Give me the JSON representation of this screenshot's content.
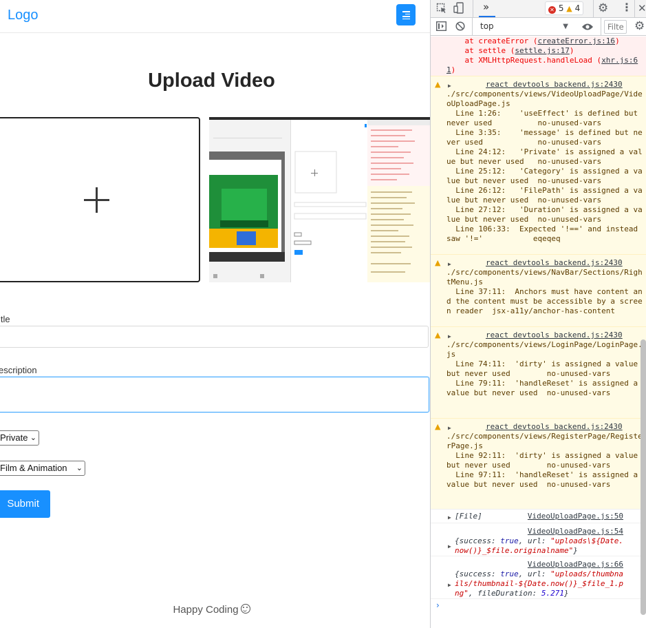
{
  "app": {
    "logo": "Logo",
    "heading": "Upload Video",
    "form": {
      "title_label": "itle",
      "description_label": "escription",
      "privacy_value": "Private",
      "category_value": "Film & Animation",
      "submit_label": "Submit"
    },
    "footer": "Happy Coding"
  },
  "devtools": {
    "more_tabs": "»",
    "errors": "5",
    "warnings": "4",
    "context": "top",
    "filter_placeholder": "Filte",
    "error_trace": [
      "    at createError (",
      "createError.js:16",
      ")",
      "    at settle (",
      "settle.js:17",
      ")",
      "    at XMLHttpRequest.handleLoad (",
      "xhr.js:61",
      ")"
    ],
    "warnings_list": [
      {
        "source": "react devtools backend.js:2430",
        "text": "./src/components/views/VideoUploadPage/VideoUploadPage.js\n  Line 1:26:    'useEffect' is defined but never used          no-unused-vars\n  Line 3:35:    'message' is defined but never used            no-unused-vars\n  Line 24:12:   'Private' is assigned a value but never used   no-unused-vars\n  Line 25:12:   'Category' is assigned a value but never used  no-unused-vars\n  Line 26:12:   'FilePath' is assigned a value but never used  no-unused-vars\n  Line 27:12:   'Duration' is assigned a value but never used  no-unused-vars\n  Line 106:33:  Expected '!==' and instead saw '!='           eqeqeq"
      },
      {
        "source": "react devtools backend.js:2430",
        "text": "./src/components/views/NavBar/Sections/RightMenu.js\n  Line 37:11:  Anchors must have content and the content must be accessible by a screen reader  jsx-a11y/anchor-has-content"
      },
      {
        "source": "react devtools backend.js:2430",
        "text": "./src/components/views/LoginPage/LoginPage.js\n  Line 74:11:  'dirty' is assigned a value but never used        no-unused-vars\n  Line 79:11:  'handleReset' is assigned a value but never used  no-unused-vars"
      },
      {
        "source": "react devtools backend.js:2430",
        "text": "./src/components/views/RegisterPage/RegisterPage.js\n  Line 92:11:  'dirty' is assigned a value but never used        no-unused-vars\n  Line 97:11:  'handleReset' is assigned a value but never used  no-unused-vars"
      }
    ],
    "logs": [
      {
        "source": "VideoUploadPage.js:50",
        "text": "[File]"
      },
      {
        "source": "VideoUploadPage.js:54",
        "text_parts": [
          "{success: ",
          "true",
          ", url: ",
          "\"uploads\\${Date.now()}_$file.originalname\"",
          "}"
        ]
      },
      {
        "source": "VideoUploadPage.js:66",
        "text_parts": [
          "{success: ",
          "true",
          ", url: ",
          "\"uploads/thumbnails/thumbnail-${Date.now()}_$file_1.png\"",
          ", fileDuration: ",
          "5.271",
          "}"
        ]
      }
    ],
    "prompt": "›"
  }
}
